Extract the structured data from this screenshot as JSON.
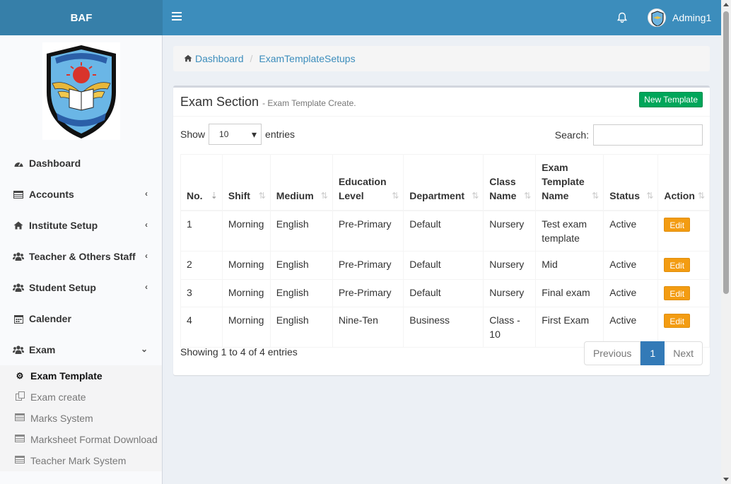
{
  "header": {
    "brand": "BAF",
    "user_name": "Adming1"
  },
  "sidebar": {
    "items": [
      {
        "label": "Dashboard",
        "icon": "dashboard-icon"
      },
      {
        "label": "Accounts",
        "icon": "table-icon"
      },
      {
        "label": "Institute Setup",
        "icon": "home-icon"
      },
      {
        "label": "Teacher & Others Staff",
        "icon": "users-icon"
      },
      {
        "label": "Student Setup",
        "icon": "users-icon"
      },
      {
        "label": "Calender",
        "icon": "calendar-icon"
      },
      {
        "label": "Exam",
        "icon": "users-icon"
      }
    ],
    "exam_submenu": [
      {
        "label": "Exam Template",
        "icon": "gear-icon"
      },
      {
        "label": "Exam create",
        "icon": "copy-icon"
      },
      {
        "label": "Marks System",
        "icon": "table-icon"
      },
      {
        "label": "Marksheet Format Download",
        "icon": "table-icon"
      },
      {
        "label": "Teacher Mark System",
        "icon": "table-icon"
      }
    ]
  },
  "breadcrumb": {
    "home": "Dashboard",
    "current": "ExamTemplateSetups"
  },
  "box": {
    "title": "Exam Section",
    "subtitle": "- Exam Template Create.",
    "new_button": "New Template"
  },
  "controls": {
    "show_label": "Show",
    "entries_label": "entries",
    "length_value": "10",
    "search_label": "Search:",
    "search_value": ""
  },
  "table": {
    "columns": [
      "No.",
      "Shift",
      "Medium",
      "Education Level",
      "Department",
      "Class Name",
      "Exam Template Name",
      "Status",
      "Action"
    ],
    "rows": [
      {
        "no": "1",
        "shift": "Morning",
        "medium": "English",
        "level": "Pre-Primary",
        "dept": "Default",
        "class": "Nursery",
        "template": "Test exam template",
        "status": "Active",
        "action": "Edit"
      },
      {
        "no": "2",
        "shift": "Morning",
        "medium": "English",
        "level": "Pre-Primary",
        "dept": "Default",
        "class": "Nursery",
        "template": "Mid",
        "status": "Active",
        "action": "Edit"
      },
      {
        "no": "3",
        "shift": "Morning",
        "medium": "English",
        "level": "Pre-Primary",
        "dept": "Default",
        "class": "Nursery",
        "template": "Final exam",
        "status": "Active",
        "action": "Edit"
      },
      {
        "no": "4",
        "shift": "Morning",
        "medium": "English",
        "level": "Nine-Ten",
        "dept": "Business",
        "class": "Class - 10",
        "template": "First Exam",
        "status": "Active",
        "action": "Edit"
      }
    ]
  },
  "footer": {
    "info": "Showing 1 to 4 of 4 entries",
    "prev": "Previous",
    "page": "1",
    "next": "Next"
  }
}
